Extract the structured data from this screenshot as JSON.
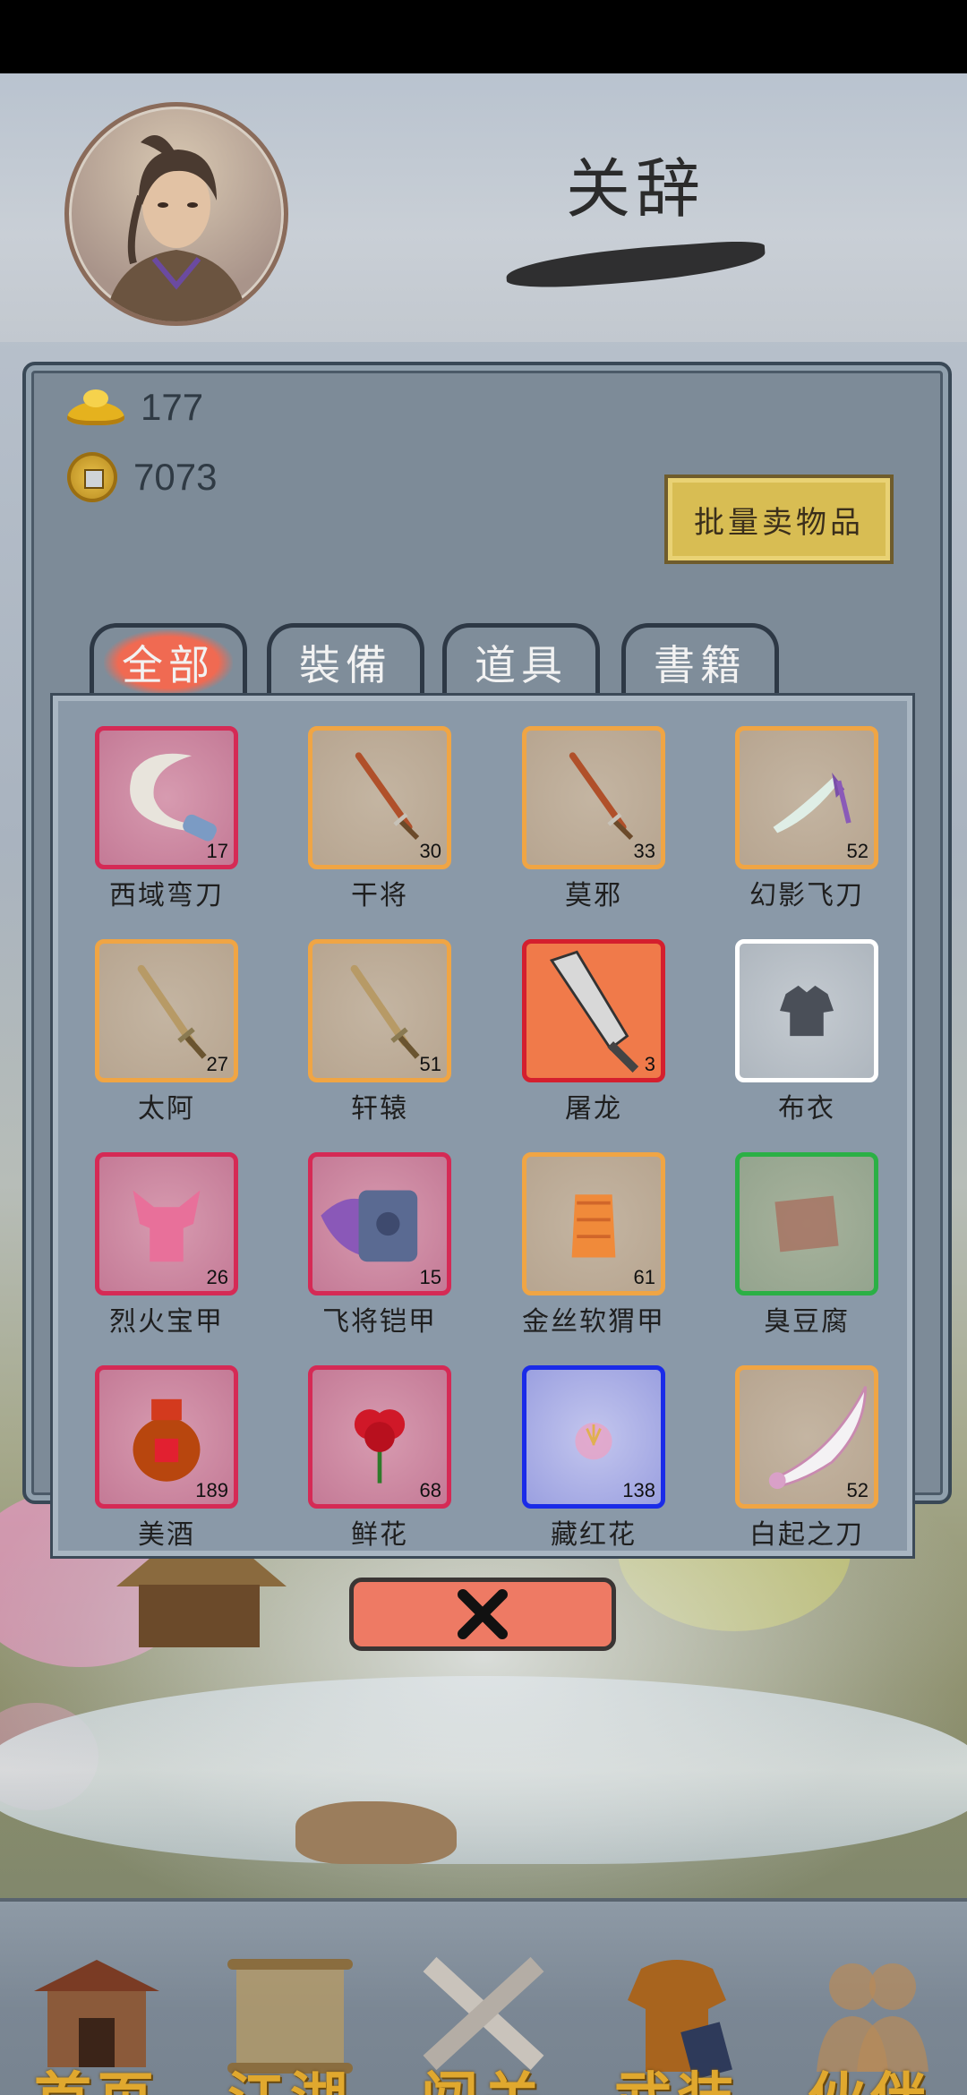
{
  "player": {
    "name": "关辞"
  },
  "currency": {
    "ingot": "177",
    "coin": "7073"
  },
  "actions": {
    "bulk_sell": "批量卖物品"
  },
  "tabs": [
    "全部",
    "裝備",
    "道具",
    "書籍"
  ],
  "active_tab": "全部",
  "items": [
    {
      "name": "西域弯刀",
      "count": "17",
      "rarity": "red",
      "icon": "curved-sabre-icon"
    },
    {
      "name": "干将",
      "count": "30",
      "rarity": "orange",
      "icon": "sword-icon"
    },
    {
      "name": "莫邪",
      "count": "33",
      "rarity": "orange",
      "icon": "sword-icon"
    },
    {
      "name": "幻影飞刀",
      "count": "52",
      "rarity": "orange",
      "icon": "throwing-knife-icon"
    },
    {
      "name": "太阿",
      "count": "27",
      "rarity": "orange",
      "icon": "golden-sword-icon"
    },
    {
      "name": "轩辕",
      "count": "51",
      "rarity": "orange",
      "icon": "golden-sword-icon"
    },
    {
      "name": "屠龙",
      "count": "3",
      "rarity": "red-solid",
      "icon": "broadsword-icon"
    },
    {
      "name": "布衣",
      "count": "",
      "rarity": "white",
      "icon": "cloth-shirt-icon"
    },
    {
      "name": "烈火宝甲",
      "count": "26",
      "rarity": "red",
      "icon": "fire-armor-icon"
    },
    {
      "name": "飞将铠甲",
      "count": "15",
      "rarity": "red",
      "icon": "winged-armor-icon"
    },
    {
      "name": "金丝软猬甲",
      "count": "61",
      "rarity": "orange",
      "icon": "golden-vest-icon"
    },
    {
      "name": "臭豆腐",
      "count": "",
      "rarity": "green",
      "icon": "tofu-icon"
    },
    {
      "name": "美酒",
      "count": "189",
      "rarity": "red",
      "icon": "wine-jar-icon"
    },
    {
      "name": "鲜花",
      "count": "68",
      "rarity": "red",
      "icon": "rose-icon"
    },
    {
      "name": "藏红花",
      "count": "138",
      "rarity": "blue",
      "icon": "saffron-flower-icon"
    },
    {
      "name": "白起之刀",
      "count": "52",
      "rarity": "orange",
      "icon": "white-blade-icon"
    }
  ],
  "nav": [
    "首页",
    "江湖",
    "闯关",
    "武装",
    "伙伴"
  ],
  "colors": {
    "rarity_red": "#d52a55",
    "rarity_orange": "#f0a544",
    "rarity_white": "#ffffff",
    "rarity_green": "#2bb045",
    "rarity_blue": "#1a2be8",
    "nav_text": "#e0a82e",
    "close_button": "#ee7a64",
    "sell_button": "#d8bd53"
  }
}
